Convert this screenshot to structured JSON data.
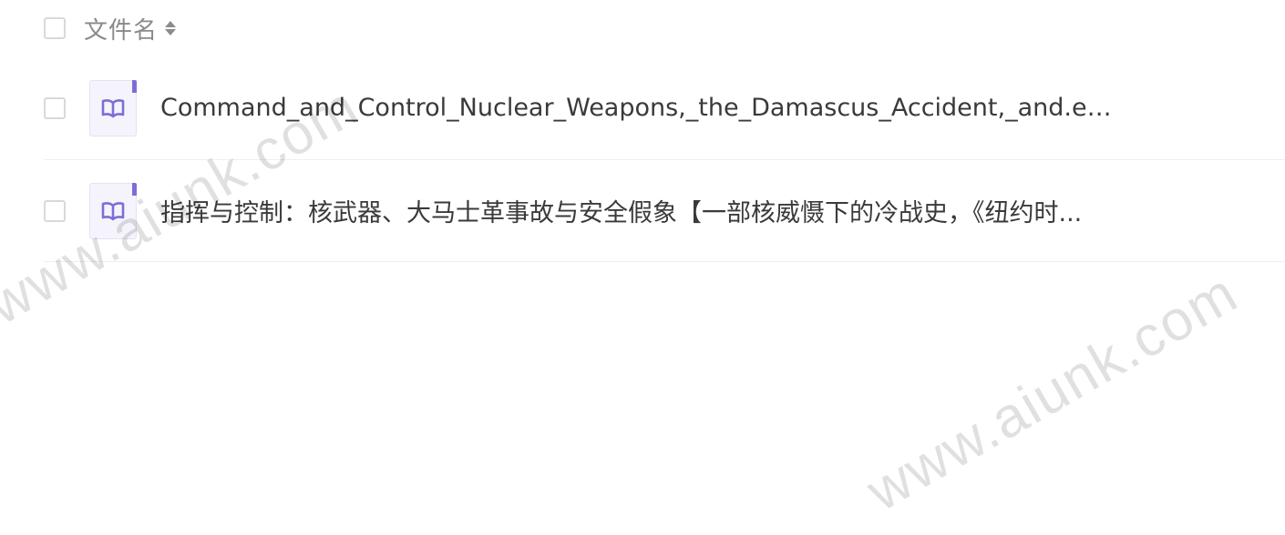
{
  "header": {
    "column_label": "文件名",
    "sort_icon": "sort-toggle-icon"
  },
  "files": [
    {
      "name": "Command_and_Control_Nuclear_Weapons,_the_Damascus_Accident,_and.epub",
      "icon": "book-icon"
    },
    {
      "name": "指挥与控制：核武器、大马士革事故与安全假象【一部核威慑下的冷战史，《纽约时...",
      "icon": "book-icon"
    }
  ],
  "watermark": {
    "text": "www.aiunk.com"
  },
  "colors": {
    "icon_accent": "#7b6fd6",
    "icon_bg": "#f5f4fc",
    "checkbox_border": "#d9d9d9",
    "header_text": "#8a8a8a",
    "row_text": "#3a3a3a",
    "divider": "#eeeeee"
  }
}
